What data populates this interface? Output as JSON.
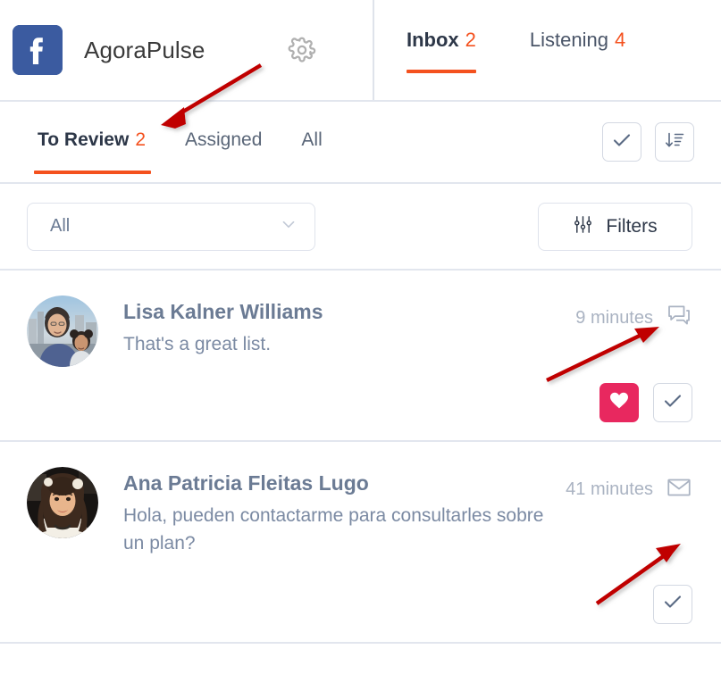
{
  "header": {
    "platform_icon": "facebook-icon",
    "profile_name": "AgoraPulse",
    "settings_icon": "gear-icon",
    "tabs": [
      {
        "label": "Inbox",
        "count": "2",
        "active": true
      },
      {
        "label": "Listening",
        "count": "4",
        "active": false
      }
    ]
  },
  "subtabs": {
    "items": [
      {
        "label": "To Review",
        "count": "2",
        "active": true
      },
      {
        "label": "Assigned",
        "count": "",
        "active": false
      },
      {
        "label": "All",
        "count": "",
        "active": false
      }
    ],
    "actions": [
      {
        "name": "mark-all-reviewed-button",
        "icon": "check-icon"
      },
      {
        "name": "sort-button",
        "icon": "sort-descending-icon"
      }
    ]
  },
  "filterbar": {
    "select": {
      "value": "All",
      "placeholder": "All",
      "chevron_icon": "chevron-down-icon",
      "options": [
        "All"
      ]
    },
    "filters_button": {
      "label": "Filters",
      "icon": "sliders-icon"
    }
  },
  "messages": [
    {
      "avatar_alt": "Lisa Kalner Williams avatar",
      "name": "Lisa Kalner Williams",
      "text": "That's a great list.",
      "time": "9 minutes",
      "type_icon": "comment-bubble-icon",
      "actions": [
        {
          "name": "like-heart-button",
          "icon": "heart-icon",
          "color": "#e8285f",
          "active": true
        },
        {
          "name": "review-check-button",
          "icon": "check-icon",
          "active": false
        }
      ]
    },
    {
      "avatar_alt": "Ana Patricia Fleitas Lugo avatar",
      "name": "Ana Patricia Fleitas Lugo",
      "text": "Hola, pueden contactarme para consultarles sobre un plan?",
      "time": "41 minutes",
      "type_icon": "envelope-icon",
      "actions": [
        {
          "name": "review-check-button",
          "icon": "check-icon",
          "active": false
        }
      ]
    }
  ],
  "annotations": [
    {
      "name": "arrow-to-review-tab",
      "color": "#c00000"
    },
    {
      "name": "arrow-comment-icon",
      "color": "#c00000"
    },
    {
      "name": "arrow-envelope-icon",
      "color": "#c00000"
    }
  ],
  "colors": {
    "accent_orange": "#f4511e",
    "facebook_blue": "#3b5ba0",
    "heart_pink": "#e8285f",
    "divider": "#e2e6ee",
    "text_muted": "#7b8aa3",
    "annotation_red": "#c00000"
  }
}
